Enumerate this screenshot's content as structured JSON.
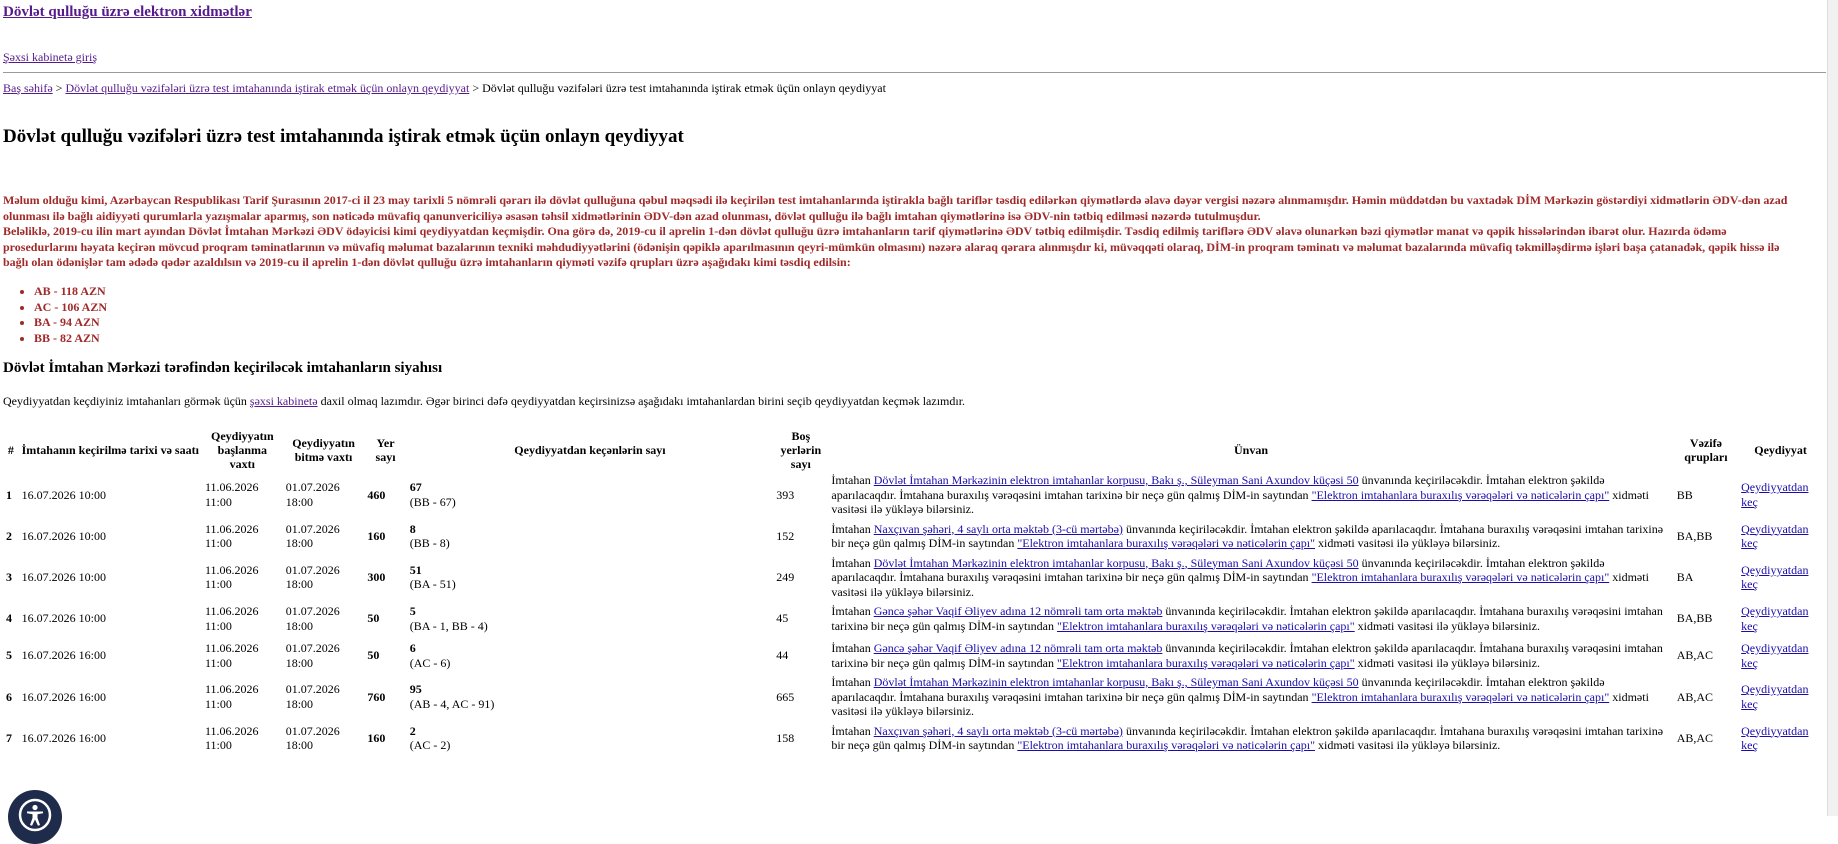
{
  "header": {
    "site_title": "Dövlət qulluğu üzrə elektron xidmətlər",
    "cabinet_link": "Şəxsi kabinetə giriş"
  },
  "breadcrumb": {
    "home": "Baş səhifə",
    "parent": "Dövlət qulluğu vəzifələri üzrə test imtahanında iştirak etmək üçün onlayn qeydiyyat",
    "current": "Dövlət qulluğu vəzifələri üzrə test imtahanında iştirak etmək üçün onlayn qeydiyyat",
    "separator": ">"
  },
  "page_title": "Dövlət qulluğu vəzifələri üzrə test imtahanında iştirak etmək üçün onlayn qeydiyyat",
  "notice": {
    "paragraph1": "Məlum olduğu kimi, Azərbaycan Respublikası Tarif Şurasının 2017-ci il 23 may tarixli 5 nömrəli qərarı ilə dövlət qulluğuna qəbul məqsədi ilə keçirilən test imtahanlarında iştirakla bağlı tariflər təsdiq edilərkən qiymətlərdə əlavə dəyər vergisi nəzərə alınmamışdır. Həmin müddətdən bu vaxtadək DİM Mərkəzin göstərdiyi xidmətlərin ƏDV-dən azad olunması ilə bağlı aidiyyəti qurumlarla yazışmalar aparmış, son nəticədə müvafiq qanunvericiliyə əsasən təhsil xidmətlərinin ƏDV-dən azad olunması, dövlət qulluğu ilə bağlı imtahan qiymətlərinə isə ƏDV-nin tətbiq edilməsi nəzərdə tutulmuşdur.",
    "paragraph2": "Beləliklə, 2019-cu ilin mart ayından Dövlət İmtahan Mərkəzi ƏDV ödəyicisi kimi qeydiyyatdan keçmişdir. Ona görə də, 2019-cu il aprelin 1-dən dövlət qulluğu üzrə imtahanların tarif qiymətlərinə ƏDV tətbiq edilmişdir. Təsdiq edilmiş tariflərə ƏDV əlavə olunarkən bəzi qiymətlər manat və qəpik hissələrindən ibarət olur. Hazırda ödəmə prosedurlarını həyata keçirən mövcud proqram təminatlarının və müvafiq məlumat bazalarının texniki məhdudiyyətlərini (ödənişin qəpiklə aparılmasının qeyri-mümkün olmasını) nəzərə alaraq qərara alınmışdır ki, müvəqqəti olaraq, DİM-in proqram təminatı və məlumat bazalarında müvafiq təkmilləşdirmə işləri başa çatanadək, qəpik hissə ilə bağlı olan ödənişlər tam ədədə qədər azaldılsın və 2019-cu il aprelin 1-dən dövlət qulluğu üzrə imtahanların qiyməti vəzifə qrupları üzrə aşağıdakı kimi təsdiq edilsin:"
  },
  "prices": [
    "AB - 118 AZN",
    "AC - 106 AZN",
    "BA - 94 AZN",
    "BB - 82 AZN"
  ],
  "section_title": "Dövlət İmtahan Mərkəzi tərəfindən keçiriləcək imtahanların siyahısı",
  "intro": {
    "before": "Qeydiyyatdan keçdiyiniz imtahanları görmək üçün",
    "link": "şəxsi kabinetə",
    "after": "daxil olmaq lazımdır. Əgər birinci dəfə qeydiyyatdan keçirsinizsə aşağıdakı imtahanlardan birini seçib qeydiyyatdan keçmək lazımdır."
  },
  "table": {
    "headers": {
      "num": "#",
      "exam_date": "İmtahanın keçirilmə tarixi və saatı",
      "reg_start": "Qeydiyyatın başlanma vaxtı",
      "reg_end": "Qeydiyyatın bitmə vaxtı",
      "seats": "Yer sayı",
      "registered": "Qeydiyyatdan keçənlərin sayı",
      "free": "Boş yerlərin sayı",
      "address": "Ünvan",
      "groups": "Vəzifə qrupları",
      "action": "Qeydiyyat"
    },
    "address_common": {
      "prefix": "İmtahan",
      "suffix1": "ünvanında keçiriləcəkdir. İmtahan elektron şəkildə aparılacaqdır. İmtahana buraxılış vərəqəsini imtahan tarixinə bir neçə gün qalmış DİM-in saytından",
      "service_link": "\"Elektron imtahanlara buraxılış vərəqələri və nəticələrin çapı\"",
      "suffix2": "xidməti vasitəsi ilə yükləyə bilərsiniz."
    },
    "rows": [
      {
        "num": "1",
        "exam_date": "16.07.2026 10:00",
        "reg_start_d": "11.06.2026",
        "reg_start_t": "11:00",
        "reg_end_d": "01.07.2026",
        "reg_end_t": "18:00",
        "seats": "460",
        "registered": "67",
        "registered_detail": "(BB - 67)",
        "free": "393",
        "place": "Dövlət İmtahan Mərkəzinin elektron imtahanlar korpusu, Bakı ş., Süleyman Sani Axundov küçəsi 50",
        "groups": "BB",
        "action": "Qeydiyyatdan keç"
      },
      {
        "num": "2",
        "exam_date": "16.07.2026 10:00",
        "reg_start_d": "11.06.2026",
        "reg_start_t": "11:00",
        "reg_end_d": "01.07.2026",
        "reg_end_t": "18:00",
        "seats": "160",
        "registered": "8",
        "registered_detail": "(BB - 8)",
        "free": "152",
        "place": "Naxçıvan şəhəri, 4 saylı orta məktəb (3-cü mərtəbə)",
        "groups": "BA,BB",
        "action": "Qeydiyyatdan keç"
      },
      {
        "num": "3",
        "exam_date": "16.07.2026 10:00",
        "reg_start_d": "11.06.2026",
        "reg_start_t": "11:00",
        "reg_end_d": "01.07.2026",
        "reg_end_t": "18:00",
        "seats": "300",
        "registered": "51",
        "registered_detail": "(BA - 51)",
        "free": "249",
        "place": "Dövlət İmtahan Mərkəzinin elektron imtahanlar korpusu, Bakı ş., Süleyman Sani Axundov küçəsi 50",
        "groups": "BA",
        "action": "Qeydiyyatdan keç"
      },
      {
        "num": "4",
        "exam_date": "16.07.2026 10:00",
        "reg_start_d": "11.06.2026",
        "reg_start_t": "11:00",
        "reg_end_d": "01.07.2026",
        "reg_end_t": "18:00",
        "seats": "50",
        "registered": "5",
        "registered_detail": "(BA - 1, BB - 4)",
        "free": "45",
        "place": "Gəncə şəhər Vaqif Əliyev adına 12 nömrəli tam orta məktəb",
        "groups": "BA,BB",
        "action": "Qeydiyyatdan keç"
      },
      {
        "num": "5",
        "exam_date": "16.07.2026 16:00",
        "reg_start_d": "11.06.2026",
        "reg_start_t": "11:00",
        "reg_end_d": "01.07.2026",
        "reg_end_t": "18:00",
        "seats": "50",
        "registered": "6",
        "registered_detail": "(AC - 6)",
        "free": "44",
        "place": "Gəncə şəhər Vaqif Əliyev adına 12 nömrəli tam orta məktəb",
        "groups": "AB,AC",
        "action": "Qeydiyyatdan keç"
      },
      {
        "num": "6",
        "exam_date": "16.07.2026 16:00",
        "reg_start_d": "11.06.2026",
        "reg_start_t": "11:00",
        "reg_end_d": "01.07.2026",
        "reg_end_t": "18:00",
        "seats": "760",
        "registered": "95",
        "registered_detail": "(AB - 4, AC - 91)",
        "free": "665",
        "place": "Dövlət İmtahan Mərkəzinin elektron imtahanlar korpusu, Bakı ş., Süleyman Sani Axundov küçəsi 50",
        "groups": "AB,AC",
        "action": "Qeydiyyatdan keç"
      },
      {
        "num": "7",
        "exam_date": "16.07.2026 16:00",
        "reg_start_d": "11.06.2026",
        "reg_start_t": "11:00",
        "reg_end_d": "01.07.2026",
        "reg_end_t": "18:00",
        "seats": "160",
        "registered": "2",
        "registered_detail": "(AC - 2)",
        "free": "158",
        "place": "Naxçıvan şəhəri, 4 saylı orta məktəb (3-cü mərtəbə)",
        "groups": "AB,AC",
        "action": "Qeydiyyatdan keç"
      }
    ]
  },
  "accessibility": {
    "icon": "accessibility-icon",
    "bg_color": "#1f2b4a"
  },
  "colors": {
    "notice": "#a02a2a",
    "link": "#1a0dab",
    "visited_link": "#551a8b"
  }
}
